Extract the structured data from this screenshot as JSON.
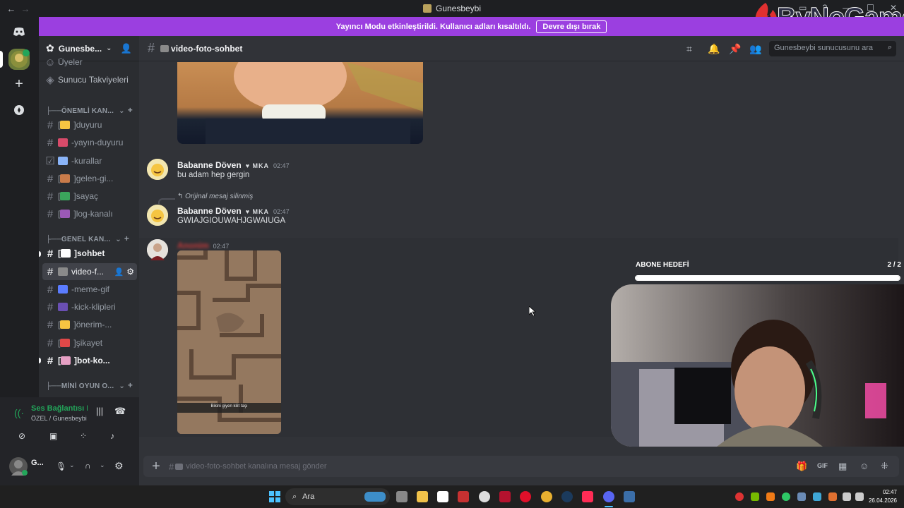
{
  "window": {
    "title": "Gunesbeybi",
    "back": "←",
    "forward": "→"
  },
  "banner": {
    "text": "Yayıncı Modu etkinleştirildi. Kullanıcı adları kısaltıldı.",
    "button": "Devre dışı bırak"
  },
  "logo": {
    "text": "ByNoGame"
  },
  "server": {
    "name": "Gunesbe...",
    "boosts_label": "Sunucu Takviyeleri",
    "members_label": "Üyeler"
  },
  "categories": [
    {
      "label": "ÖNEMLİ KAN..."
    },
    {
      "label": "GENEL KAN..."
    },
    {
      "label": "MİNİ OYUN O..."
    }
  ],
  "channels": [
    {
      "label": "duyuru",
      "emoji_color": "#f5c542",
      "icon": "hash"
    },
    {
      "label": "-yayın-duyuru",
      "emoji_color": "#d84b6a",
      "icon": "hash"
    },
    {
      "label": "-kurallar",
      "emoji_color": "#8ab4f8",
      "icon": "rules"
    },
    {
      "label": "gelen-gi...",
      "emoji_color": "#c97b4a",
      "icon": "hash"
    },
    {
      "label": "sayaç",
      "emoji_color": "#3ba55c",
      "icon": "hash"
    },
    {
      "label": "log-kanalı",
      "emoji_color": "#9b59b6",
      "icon": "hash"
    },
    {
      "label": "sohbet",
      "emoji_color": "#ffffff",
      "icon": "hash"
    },
    {
      "label": "video-f...",
      "emoji_color": "#8a8a8a",
      "icon": "hash"
    },
    {
      "label": "-meme-gif",
      "emoji_color": "#5b7cff",
      "icon": "hash"
    },
    {
      "label": "-kick-klipleri",
      "emoji_color": "#6a4fb3",
      "icon": "hash"
    },
    {
      "label": "önerim-...",
      "emoji_color": "#f5c542",
      "icon": "hash"
    },
    {
      "label": "şikayet",
      "emoji_color": "#e04848",
      "icon": "hash"
    },
    {
      "label": "bot-ko...",
      "emoji_color": "#e6a0c4",
      "icon": "hash"
    }
  ],
  "channel_header": {
    "name": "video-foto-sohbet",
    "search_placeholder": "Gunesbeybi sunucusunu ara"
  },
  "messages": [
    {
      "author": "Babanne Döven",
      "badge": "MKA",
      "time": "02:47",
      "text": "bu adam hep gergin"
    },
    {
      "reply": "Orijinal mesaj silinmiş",
      "author": "Babanne Döven",
      "badge": "MKA",
      "time": "02:47",
      "text": "GWIAJGIOUWAHJGWAIUGA"
    },
    {
      "author": "Anonim",
      "time": "02:47",
      "image_caption": "Bikini giyen kilit taşı"
    }
  ],
  "composer": {
    "placeholder": "video-foto-sohbet kanalına mesaj gönder"
  },
  "voice": {
    "status": "Ses Bağlantısı K",
    "location": "ÖZEL / Gunesbeybi"
  },
  "user": {
    "name": "G..."
  },
  "goal": {
    "label": "ABONE HEDEFİ",
    "count": "2 / 2",
    "progress": 1.0
  },
  "taskbar": {
    "search": "Ara",
    "time": "02:47",
    "date": "26.04.2026"
  },
  "colors": {
    "accent": "#9b3fe0",
    "bg": "#313338",
    "sidebar": "#2b2d31",
    "rail": "#1e1f22"
  }
}
